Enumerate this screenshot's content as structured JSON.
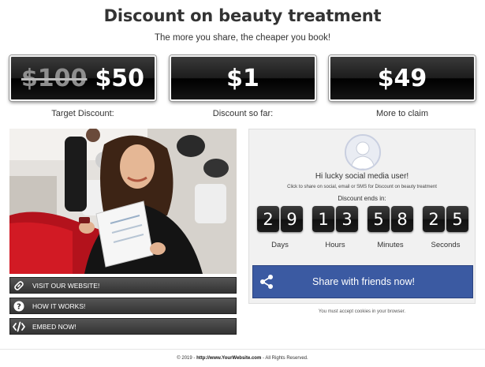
{
  "header": {
    "title": "Discount on beauty treatment",
    "subtitle": "The more you share, the cheaper you book!"
  },
  "prices": {
    "target": {
      "old": "$100",
      "new": "$50",
      "label": "Target Discount:"
    },
    "so_far": {
      "value": "$1",
      "label": "Discount so far:"
    },
    "to_claim": {
      "value": "$49",
      "label": "More to claim"
    }
  },
  "sidebar_buttons": [
    {
      "label": "VISIT OUR WEBSITE!",
      "icon": "link-icon"
    },
    {
      "label": "HOW IT WORKS!",
      "icon": "question-icon"
    },
    {
      "label": "EMBED NOW!",
      "icon": "code-icon"
    }
  ],
  "panel": {
    "greeting": "Hi lucky social media user!",
    "hint": "Click to share on social, email or SMS for Discount on beauty treatment",
    "ends_label": "Discount ends in:",
    "countdown": {
      "days": [
        "2",
        "9"
      ],
      "hours": [
        "1",
        "3"
      ],
      "minutes": [
        "5",
        "8"
      ],
      "seconds": [
        "2",
        "5"
      ]
    },
    "units": {
      "days": "Days",
      "hours": "Hours",
      "minutes": "Minutes",
      "seconds": "Seconds"
    },
    "share_label": "Share with friends now!"
  },
  "cookie_notice": "You must accept cookies in your browser.",
  "footer": {
    "prefix": "© 2019 -",
    "link": "http://www.YourWebsite.com",
    "suffix": "- All Rights Reserved."
  },
  "colors": {
    "share_button": "#3b5aa2",
    "dark_box": "#1c1c1c",
    "panel_bg": "#f1f1f1"
  }
}
